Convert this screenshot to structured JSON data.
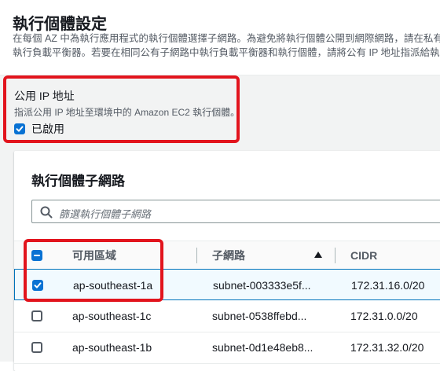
{
  "section": {
    "title": "執行個體設定",
    "desc_line1": "在每個 AZ 中為執行應用程式的執行個體選擇子網路。為避免將執行個體公開到網際網路，請在私有子",
    "desc_line2": "執行負載平衡器。若要在相同公有子網路中執行負載平衡器和執行個體，請將公有 IP 地址指派給執行個"
  },
  "public_ip": {
    "label": "公用 IP 地址",
    "description": "指派公用 IP 地址至環境中的 Amazon EC2 執行個體。",
    "checkbox_label": "已啟用",
    "checked": true
  },
  "subnets": {
    "title": "執行個體子網路",
    "filter_placeholder": "篩選執行個體子網路",
    "columns": {
      "az": "可用區域",
      "subnet": "子網路",
      "cidr": "CIDR"
    },
    "rows": [
      {
        "az": "ap-southeast-1a",
        "subnet": "subnet-003333e5f...",
        "cidr": "172.31.16.0/20",
        "checked": true
      },
      {
        "az": "ap-southeast-1c",
        "subnet": "subnet-0538ffebd...",
        "cidr": "172.31.0.0/20",
        "checked": false
      },
      {
        "az": "ap-southeast-1b",
        "subnet": "subnet-0d1e48eb8...",
        "cidr": "172.31.32.0/20",
        "checked": false
      }
    ]
  },
  "colors": {
    "accent": "#0972d3",
    "highlight": "#e2141d",
    "selected_row_bg": "#f1faff"
  },
  "icons": {
    "filter": "search-icon",
    "sort": "sort-ascending-icon"
  }
}
